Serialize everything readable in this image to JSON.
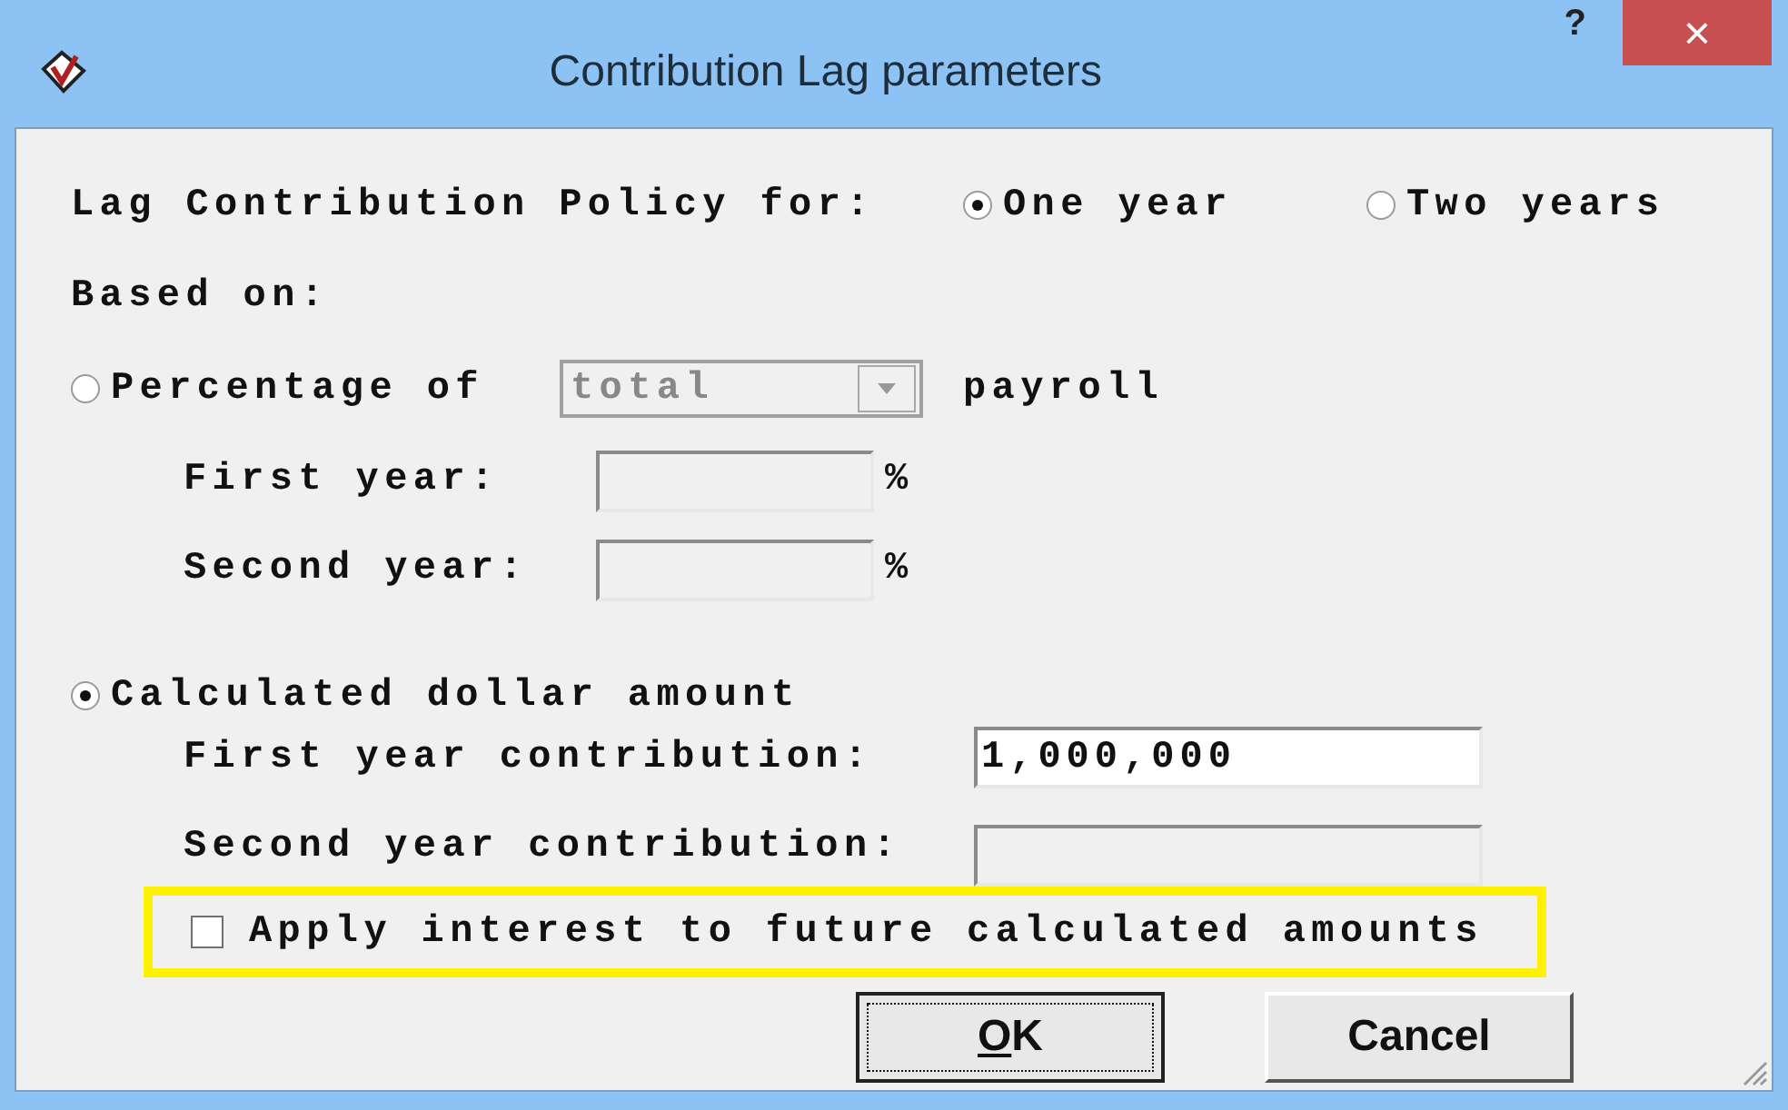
{
  "window": {
    "title": "Contribution Lag parameters",
    "help_button": "?",
    "close_button": "×"
  },
  "policy": {
    "label": "Lag Contribution Policy for:",
    "options": [
      {
        "label": "One year",
        "selected": true
      },
      {
        "label": "Two years",
        "selected": false
      }
    ]
  },
  "based_on": "Based on:",
  "methods": [
    {
      "kind": "percentage",
      "label": "Percentage of",
      "selected": false,
      "dropdown": {
        "value": "total",
        "disabled": true
      },
      "suffix": "payroll",
      "fields": [
        {
          "label": "First year:",
          "unit": "%",
          "disabled": true
        },
        {
          "label": "Second year:",
          "unit": "%",
          "disabled": true
        }
      ]
    },
    {
      "kind": "dollar",
      "label": "Calculated dollar amount",
      "selected": true,
      "fields": [
        {
          "label": "First year contribution:",
          "value": "1,000,000",
          "disabled": false
        },
        {
          "label": "Second year contribution:",
          "disabled": true
        }
      ]
    }
  ],
  "checkbox": {
    "label": "Apply interest to future calculated amounts",
    "checked": false
  },
  "buttons": [
    {
      "label": "OK",
      "default": true
    },
    {
      "label": "Cancel",
      "default": false
    }
  ]
}
